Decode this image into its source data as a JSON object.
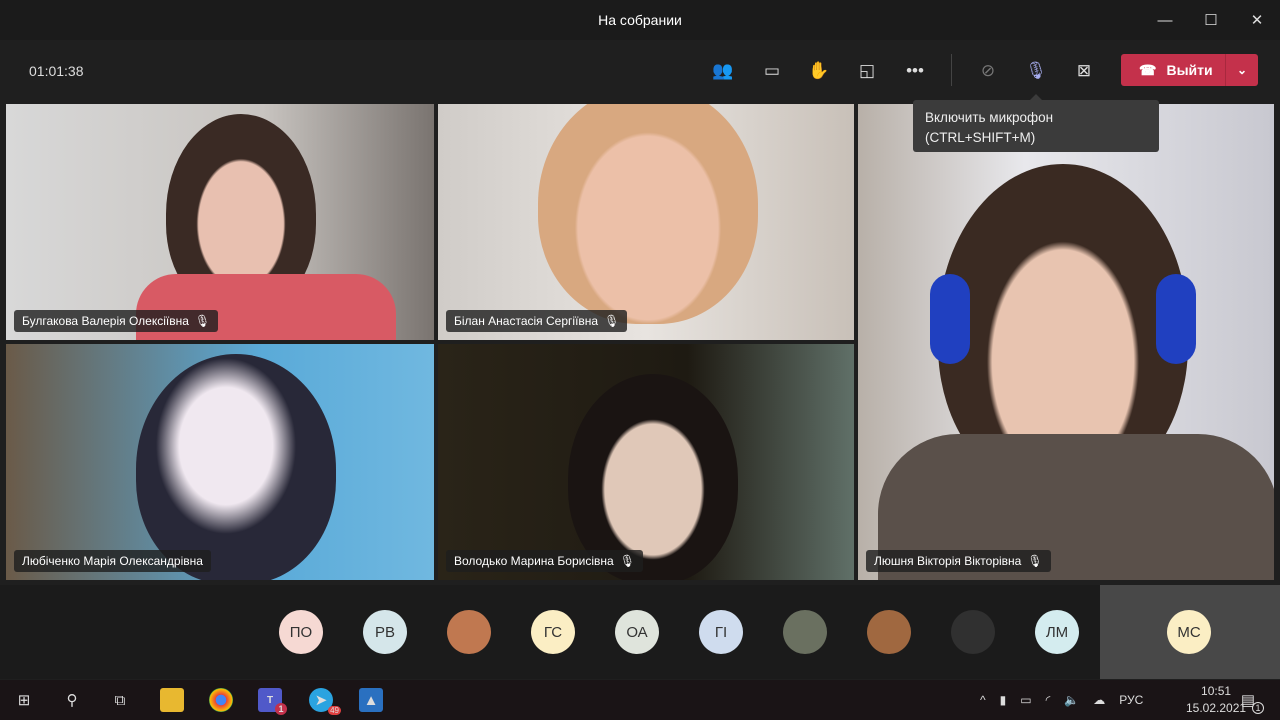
{
  "window": {
    "title": "На собрании",
    "minimize": "—",
    "maximize": "☐",
    "close": "✕"
  },
  "toolbar": {
    "timer": "01:01:38",
    "leave_label": "Выйти"
  },
  "tooltip": {
    "line1": "Включить микрофон",
    "line2": "(CTRL+SHIFT+M)"
  },
  "participants": [
    {
      "name": "Булгакова Валерія Олексіївна",
      "muted": true
    },
    {
      "name": "Білан Анастасія Сергіївна",
      "muted": true
    },
    {
      "name": "Любіченко Марія Олександрівна",
      "muted": false
    },
    {
      "name": "Володько Марина Борисівна",
      "muted": true
    },
    {
      "name": "Люшня Вікторія Вікторівна",
      "muted": true
    }
  ],
  "avatars": [
    {
      "initials": "ПО",
      "color": "#f6d9d3"
    },
    {
      "initials": "РВ",
      "color": "#d5e6ea"
    },
    {
      "initials": "",
      "color": "#c07850"
    },
    {
      "initials": "ГС",
      "color": "#fbeec4"
    },
    {
      "initials": "ОА",
      "color": "#dfe4dc"
    },
    {
      "initials": "ГІ",
      "color": "#cfdcee"
    },
    {
      "initials": "",
      "color": "#6a7060"
    },
    {
      "initials": "",
      "color": "#a06840"
    },
    {
      "initials": "",
      "color": "#303030"
    },
    {
      "initials": "ЛМ",
      "color": "#d4ecef"
    }
  ],
  "self_avatar": {
    "initials": "МС",
    "color": "#fbeec4"
  },
  "taskbar": {
    "teams_badge": "1",
    "telegram_badge": "49",
    "language": "РУС",
    "time": "10:51",
    "date": "15.02.2021",
    "notifications": "1"
  }
}
